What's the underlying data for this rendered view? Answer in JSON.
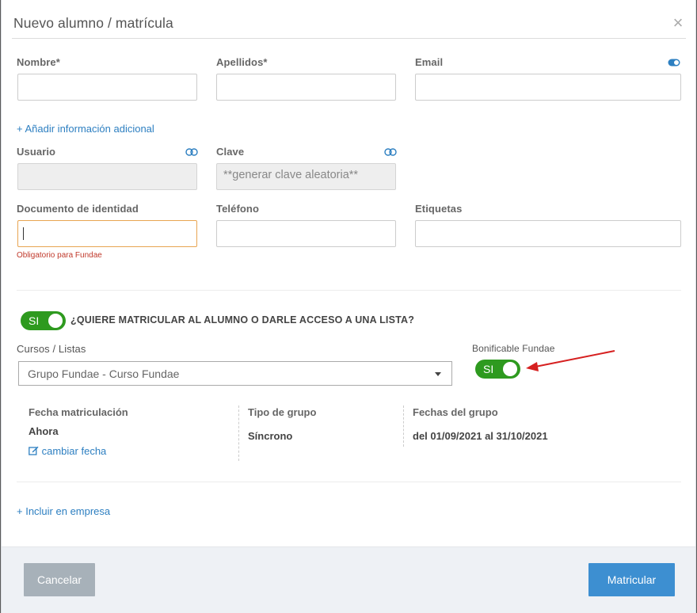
{
  "dialog": {
    "title": "Nuevo alumno / matrícula",
    "close_glyph": "×"
  },
  "form": {
    "nombre_label": "Nombre*",
    "apellidos_label": "Apellidos*",
    "email_label": "Email",
    "add_info_link": "+ Añadir información adicional",
    "usuario_label": "Usuario",
    "clave_label": "Clave",
    "clave_placeholder": "**generar clave aleatoria**",
    "documento_label": "Documento de identidad",
    "documento_hint": "Obligatorio para Fundae",
    "telefono_label": "Teléfono",
    "etiquetas_label": "Etiquetas"
  },
  "enrollment": {
    "toggle_label": "SI",
    "toggle_on": true,
    "question": "¿QUIERE MATRICULAR AL ALUMNO O DARLE ACCESO A UNA LISTA?",
    "cursos_label": "Cursos / Listas",
    "cursos_selected": "Grupo Fundae - Curso Fundae",
    "bonificable_label": "Bonificable Fundae",
    "bonificable_toggle_label": "SI",
    "bonificable_on": true
  },
  "group_info": {
    "fecha_label": "Fecha matriculación",
    "fecha_value": "Ahora",
    "cambiar_fecha_link": "cambiar fecha",
    "tipo_label": "Tipo de grupo",
    "tipo_value": "Síncrono",
    "fechas_label": "Fechas del grupo",
    "fechas_value": "del 01/09/2021 al 31/10/2021"
  },
  "incluir_empresa_link": "+ Incluir en empresa",
  "footer": {
    "cancel_label": "Cancelar",
    "submit_label": "Matricular"
  },
  "colors": {
    "accent": "#3d8fd1",
    "link": "#2d7fc1",
    "toggle_on": "#2e9a1f",
    "error": "#c0392b",
    "focus_border": "#e8a552",
    "annotation_arrow": "#d62020"
  },
  "icons": {
    "close": "close-icon",
    "email_toggle": "toggle-icon",
    "usuario_link": "link-icon",
    "clave_link": "link-icon",
    "dropdown": "chevron-down-icon",
    "edit": "edit-icon",
    "annotation": "red-arrow-icon"
  }
}
